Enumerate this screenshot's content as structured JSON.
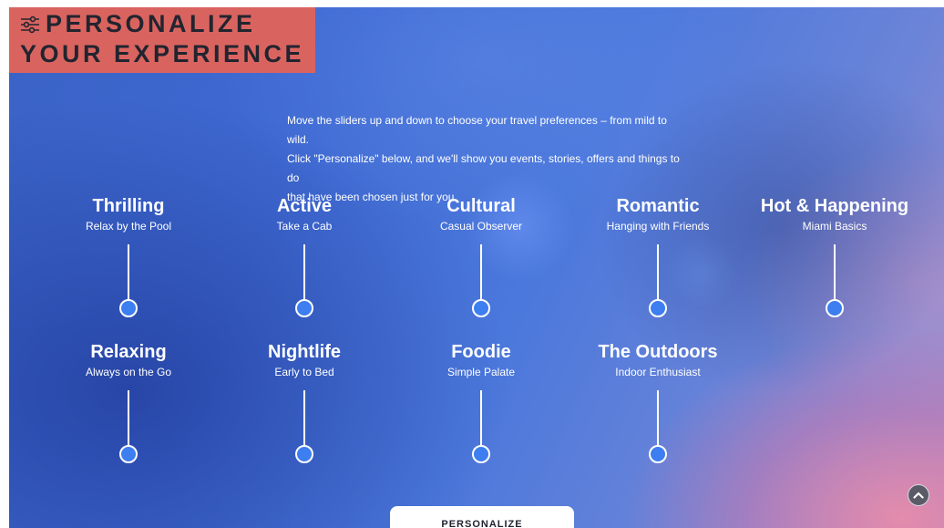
{
  "header": {
    "title_line1": "PERSONALIZE",
    "title_line2": "YOUR EXPERIENCE",
    "icon": "sliders-icon"
  },
  "intro": {
    "line1": "Move the sliders up and down to choose your travel preferences – from mild to wild.",
    "line2": "Click \"Personalize\" below, and we'll show you events, stories, offers and things to do",
    "line3": "that have been chosen just for you."
  },
  "sliders": [
    {
      "label": "Thrilling",
      "current": "Relax by the Pool",
      "level": 0
    },
    {
      "label": "Active",
      "current": "Take a Cab",
      "level": 0
    },
    {
      "label": "Cultural",
      "current": "Casual Observer",
      "level": 0
    },
    {
      "label": "Romantic",
      "current": "Hanging with Friends",
      "level": 0
    },
    {
      "label": "Hot & Happening",
      "current": "Miami Basics",
      "level": 0
    },
    {
      "label": "Relaxing",
      "current": "Always on the Go",
      "level": 0
    },
    {
      "label": "Nightlife",
      "current": "Early to Bed",
      "level": 0
    },
    {
      "label": "Foodie",
      "current": "Simple Palate",
      "level": 0
    },
    {
      "label": "The Outdoors",
      "current": "Indoor Enthusiast",
      "level": 0
    }
  ],
  "actions": {
    "personalize_label": "PERSONALIZE",
    "scroll_top_icon": "chevron-up-icon"
  },
  "colors": {
    "title_bg": "#d9645f",
    "knob": "#3d7ef0",
    "title_text": "#22242f"
  }
}
